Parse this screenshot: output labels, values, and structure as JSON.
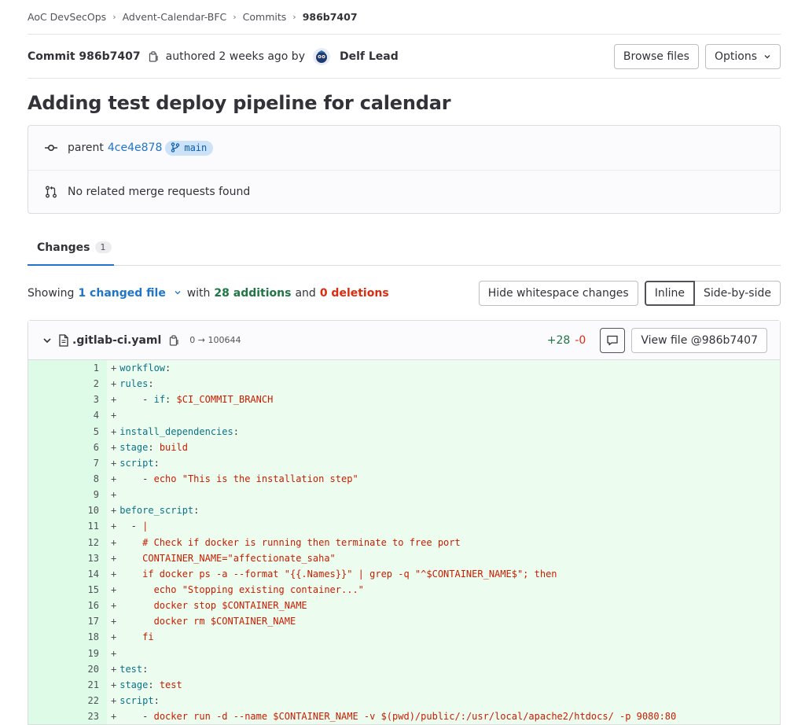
{
  "breadcrumb": [
    "AoC DevSecOps",
    "Advent-Calendar-BFC",
    "Commits",
    "986b7407"
  ],
  "commit": {
    "label": "Commit 986b7407",
    "authored": "authored 2 weeks ago by",
    "author": "Delf Lead",
    "browse_label": "Browse files",
    "options_label": "Options",
    "title": "Adding test deploy pipeline for calendar",
    "parent_label": "parent",
    "parent_sha": "4ce4e878",
    "branch": "main",
    "mr_text": "No related merge requests found"
  },
  "tabs": {
    "changes_label": "Changes",
    "changes_count": "1"
  },
  "summary": {
    "showing": "Showing",
    "changed": "1 changed file",
    "with": "with",
    "additions": "28 additions",
    "and": "and",
    "deletions": "0 deletions",
    "hide_ws": "Hide whitespace changes",
    "inline": "Inline",
    "side": "Side-by-side"
  },
  "file": {
    "name": ".gitlab-ci.yaml",
    "mode": "0 → 100644",
    "plus": "+28",
    "minus": "-0",
    "view_label": "View file @986b7407"
  },
  "code_lines": [
    {
      "n": "1",
      "t": "workflow:"
    },
    {
      "n": "2",
      "t": "  rules:"
    },
    {
      "n": "3",
      "t": "    - if: $CI_COMMIT_BRANCH"
    },
    {
      "n": "4",
      "t": ""
    },
    {
      "n": "5",
      "t": "install_dependencies:"
    },
    {
      "n": "6",
      "t": "  stage: build"
    },
    {
      "n": "7",
      "t": "  script:"
    },
    {
      "n": "8",
      "t": "    - echo \"This is the installation step\""
    },
    {
      "n": "9",
      "t": ""
    },
    {
      "n": "10",
      "t": "before_script:"
    },
    {
      "n": "11",
      "t": "  - |"
    },
    {
      "n": "12",
      "t": "    # Check if docker is running then terminate to free port"
    },
    {
      "n": "13",
      "t": "    CONTAINER_NAME=\"affectionate_saha\""
    },
    {
      "n": "14",
      "t": "    if docker ps -a --format \"{{.Names}}\" | grep -q \"^$CONTAINER_NAME$\"; then"
    },
    {
      "n": "15",
      "t": "      echo \"Stopping existing container...\""
    },
    {
      "n": "16",
      "t": "      docker stop $CONTAINER_NAME"
    },
    {
      "n": "17",
      "t": "      docker rm $CONTAINER_NAME"
    },
    {
      "n": "18",
      "t": "    fi"
    },
    {
      "n": "19",
      "t": ""
    },
    {
      "n": "20",
      "t": "test:"
    },
    {
      "n": "21",
      "t": "  stage: test"
    },
    {
      "n": "22",
      "t": "  script:"
    },
    {
      "n": "23",
      "t": "    - docker run -d --name $CONTAINER_NAME -v $(pwd)/public/:/usr/local/apache2/htdocs/ -p 9080:80"
    }
  ]
}
